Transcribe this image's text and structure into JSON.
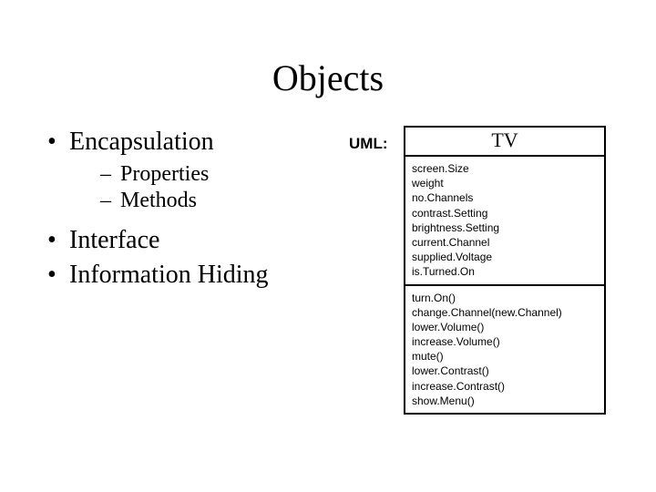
{
  "slide": {
    "title": "Objects",
    "bullets": [
      {
        "text": "Encapsulation",
        "children": [
          {
            "text": "Properties"
          },
          {
            "text": "Methods"
          }
        ]
      },
      {
        "text": "Interface"
      },
      {
        "text": "Information Hiding"
      }
    ],
    "uml_label": "UML:",
    "uml": {
      "class_name": "TV",
      "attributes": [
        "screen.Size",
        "weight",
        "no.Channels",
        "contrast.Setting",
        "brightness.Setting",
        "current.Channel",
        "supplied.Voltage",
        "is.Turned.On"
      ],
      "operations": [
        "turn.On()",
        "change.Channel(new.Channel)",
        "lower.Volume()",
        "increase.Volume()",
        "mute()",
        "lower.Contrast()",
        "increase.Contrast()",
        "show.Menu()"
      ]
    },
    "marks": {
      "dot": "•",
      "dash": "–"
    }
  }
}
